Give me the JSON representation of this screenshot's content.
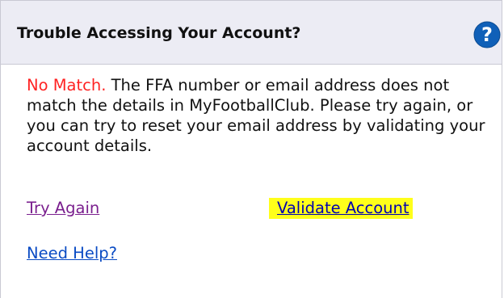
{
  "dialog": {
    "title": "Trouble Accessing Your Account?",
    "help_icon": "question-circle-icon"
  },
  "message": {
    "lead": "No Match.",
    "body": " The FFA number or email address does not match the details in MyFootballClub. Please try again, or you can try to reset your email address by validating your account details."
  },
  "links": {
    "try_again": "Try Again",
    "validate_account": "Validate Account",
    "need_help": "Need Help?"
  },
  "colors": {
    "header_bg": "#ececf4",
    "error_text": "#ff2222",
    "highlight": "#ffff1a",
    "help_icon": "#1060b8"
  }
}
